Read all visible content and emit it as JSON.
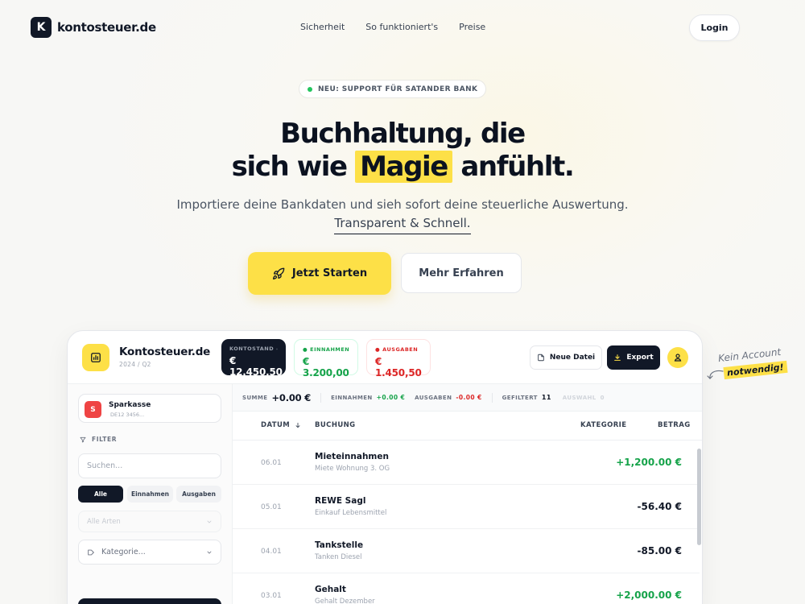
{
  "nav": {
    "logo_letter": "K",
    "logo_text": "kontosteuer.de",
    "links": [
      "Sicherheit",
      "So funktioniert's",
      "Preise"
    ],
    "login": "Login"
  },
  "hero": {
    "badge": "NEU: SUPPORT FÜR SATANDER BANK",
    "headline_1": "Buchhaltung, die",
    "headline_2a": "sich wie",
    "headline_highlight": "Magie",
    "headline_2b": "anfühlt.",
    "subline_1": "Importiere deine Bankdaten und sieh sofort deine steuerliche Auswertung.",
    "subline_2": "Transparent & Schnell.",
    "cta_primary": "Jetzt Starten",
    "cta_secondary": "Mehr Erfahren"
  },
  "dashboard": {
    "title": "Kontosteuer.de",
    "period": "2024 / Q2",
    "stats": {
      "balance_label": "KONTOSTAND",
      "balance_value": "€ 12.450,50",
      "income_label": "EINNAHMEN",
      "income_value": "€ 3.200,00",
      "expense_label": "AUSGABEN",
      "expense_value": "€ 1.450,50"
    },
    "new_file": "Neue Datei",
    "export": "Export",
    "sidebar": {
      "bank_letter": "S",
      "bank_name": "Sparkasse",
      "bank_iban": "DE12 3456...",
      "filter_label": "FILTER",
      "search_placeholder": "Suchen...",
      "seg_all": "Alle",
      "seg_income": "Einnahmen",
      "seg_expense": "Ausgaben",
      "select_types": "Alle Arten",
      "select_category": "Kategorie..."
    },
    "summary": {
      "sum_label": "SUMME",
      "sum_value": "+0.00 €",
      "income_label": "EINNAHMEN",
      "income_value": "+0.00 €",
      "expense_label": "AUSGABEN",
      "expense_value": "-0.00 €",
      "filtered_label": "GEFILTERT",
      "filtered_value": "11",
      "selection_label": "AUSWAHL",
      "selection_value": "0"
    },
    "table": {
      "col_date": "DATUM",
      "col_booking": "BUCHUNG",
      "col_category": "KATEGORIE",
      "col_amount": "BETRAG",
      "rows": [
        {
          "date": "06.01",
          "title": "Mieteinnahmen",
          "sub": "Miete Wohnung 3. OG",
          "amount": "+1,200.00 €",
          "positive": true
        },
        {
          "date": "05.01",
          "title": "REWE Sagl",
          "sub": "Einkauf Lebensmittel",
          "amount": "-56.40 €",
          "positive": false
        },
        {
          "date": "04.01",
          "title": "Tankstelle",
          "sub": "Tanken Diesel",
          "amount": "-85.00 €",
          "positive": false
        },
        {
          "date": "03.01",
          "title": "Gehalt",
          "sub": "Gehalt Dezember",
          "amount": "+2,000.00 €",
          "positive": true
        }
      ]
    }
  },
  "annotation": {
    "line_1": "Kein Account",
    "line_2": "notwendig!"
  }
}
